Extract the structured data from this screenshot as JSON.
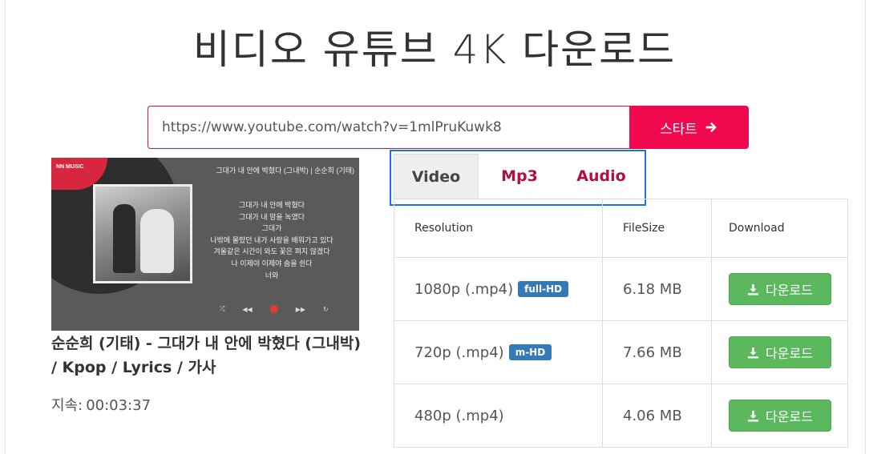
{
  "page": {
    "title": "비디오 유튜브 4K 다운로드"
  },
  "search": {
    "url_value": "https://www.youtube.com/watch?v=1mlPruKuwk8",
    "start_label": "스타트",
    "start_icon": "arrow-right-icon"
  },
  "thumbnail": {
    "channel": "NN MUSIC",
    "song_heading": "그대가 내 안에 박혔다 (그내박) | 순순희 (기태)",
    "lyrics": [
      "그대가 내 안에 박혔다",
      "그대가 내 맘을 녹였다",
      "그대가",
      "나밖에 몰랐던 내가 사랑을 배워가고 있다",
      "겨울같은 시간이 와도 꽃은 펴지 않겠다",
      "나 이제야 이제야 숨을 쉰다",
      "너와"
    ]
  },
  "video": {
    "title": "순순희 (기태) - 그대가 내 안에 박혔다 (그내박) / Kpop / Lyrics / 가사",
    "duration_label": "지속:",
    "duration_value": "00:03:37"
  },
  "tabs": [
    {
      "label": "Video",
      "active": true
    },
    {
      "label": "Mp3",
      "active": false
    },
    {
      "label": "Audio",
      "active": false
    }
  ],
  "table": {
    "headers": [
      "Resolution",
      "FileSize",
      "Download"
    ],
    "rows": [
      {
        "resolution": "1080p (.mp4)",
        "badge": "full-HD",
        "filesize": "6.18 MB",
        "button": "다운로드"
      },
      {
        "resolution": "720p (.mp4)",
        "badge": "m-HD",
        "filesize": "7.66 MB",
        "button": "다운로드"
      },
      {
        "resolution": "480p (.mp4)",
        "badge": "",
        "filesize": "4.06 MB",
        "button": "다운로드"
      }
    ]
  },
  "colors": {
    "accent": "#f0094e",
    "tab_text": "#b0103c",
    "highlight_box": "#1a73e8",
    "download_green": "#5cb85c",
    "badge_blue": "#337ab7"
  }
}
